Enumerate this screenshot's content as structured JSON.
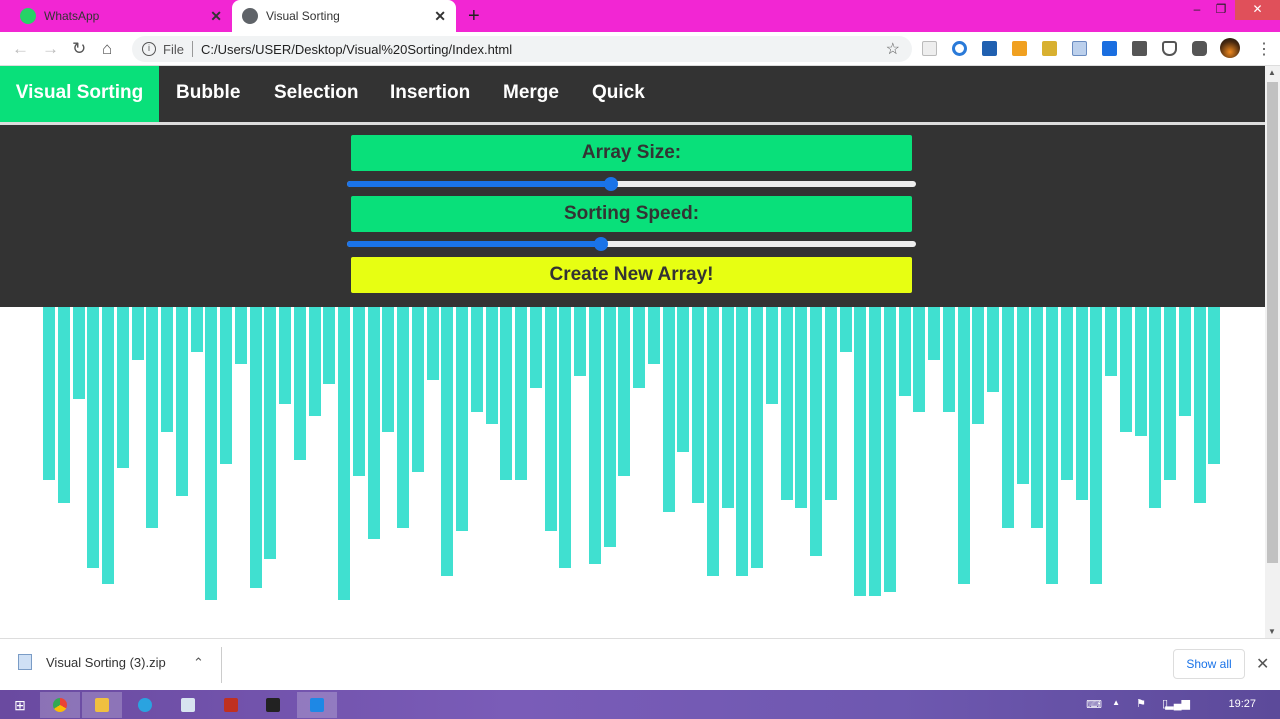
{
  "browser": {
    "tabs": [
      {
        "title": "WhatsApp",
        "icon": "whatsapp-icon",
        "active": false
      },
      {
        "title": "Visual Sorting",
        "icon": "globe-icon",
        "active": true
      }
    ],
    "new_tab_label": "+",
    "address": {
      "scheme_label": "File",
      "url": "C:/Users/USER/Desktop/Visual%20Sorting/Index.html"
    },
    "extensions": [
      "pocket-icon",
      "sync-icon",
      "clapper-icon",
      "download-icon",
      "folder-icon",
      "screenshot-icon",
      "search-icon",
      "media-icon",
      "shield-icon",
      "puzzle-icon"
    ],
    "colors": {
      "tabbar": "#f226d3"
    }
  },
  "nav": {
    "brand": "Visual Sorting",
    "links": [
      "Bubble",
      "Selection",
      "Insertion",
      "Merge",
      "Quick"
    ]
  },
  "controls": {
    "array_size_label": "Array Size:",
    "array_size_fraction": 0.464,
    "speed_label": "Sorting Speed:",
    "speed_fraction": 0.446,
    "create_button": "Create New Array!",
    "colors": {
      "label_bg": "#09e07a",
      "button_bg": "#e7ff12",
      "panel_bg": "#333333",
      "slider": "#1a73e8"
    }
  },
  "chart_data": {
    "type": "bar",
    "orientation": "hanging-from-top",
    "bar_color": "#40e0d0",
    "count": 80,
    "values": [
      173,
      196,
      92,
      261,
      277,
      161,
      53,
      221,
      125,
      189,
      45,
      293,
      157,
      57,
      281,
      252,
      97,
      153,
      109,
      77,
      293,
      169,
      232,
      125,
      221,
      165,
      73,
      269,
      224,
      105,
      117,
      173,
      173,
      81,
      224,
      261,
      69,
      257,
      240,
      169,
      81,
      57,
      205,
      145,
      196,
      269,
      201,
      269,
      261,
      97,
      193,
      201,
      249,
      193,
      45,
      289,
      289,
      285,
      89,
      105,
      53,
      105,
      277,
      117,
      85,
      221,
      177,
      221,
      277,
      173,
      193,
      277,
      69,
      125,
      129,
      201,
      173,
      109,
      196,
      157
    ],
    "ylim": [
      0,
      300
    ]
  },
  "downloads": {
    "file_name": "Visual Sorting (3).zip",
    "show_all": "Show all"
  },
  "taskbar": {
    "apps": [
      "start-icon",
      "chrome-icon",
      "file-explorer-icon",
      "telegram-icon",
      "app-window-icon",
      "media-app-icon",
      "app-icon",
      "vscode-icon"
    ],
    "clock": "19:27"
  }
}
